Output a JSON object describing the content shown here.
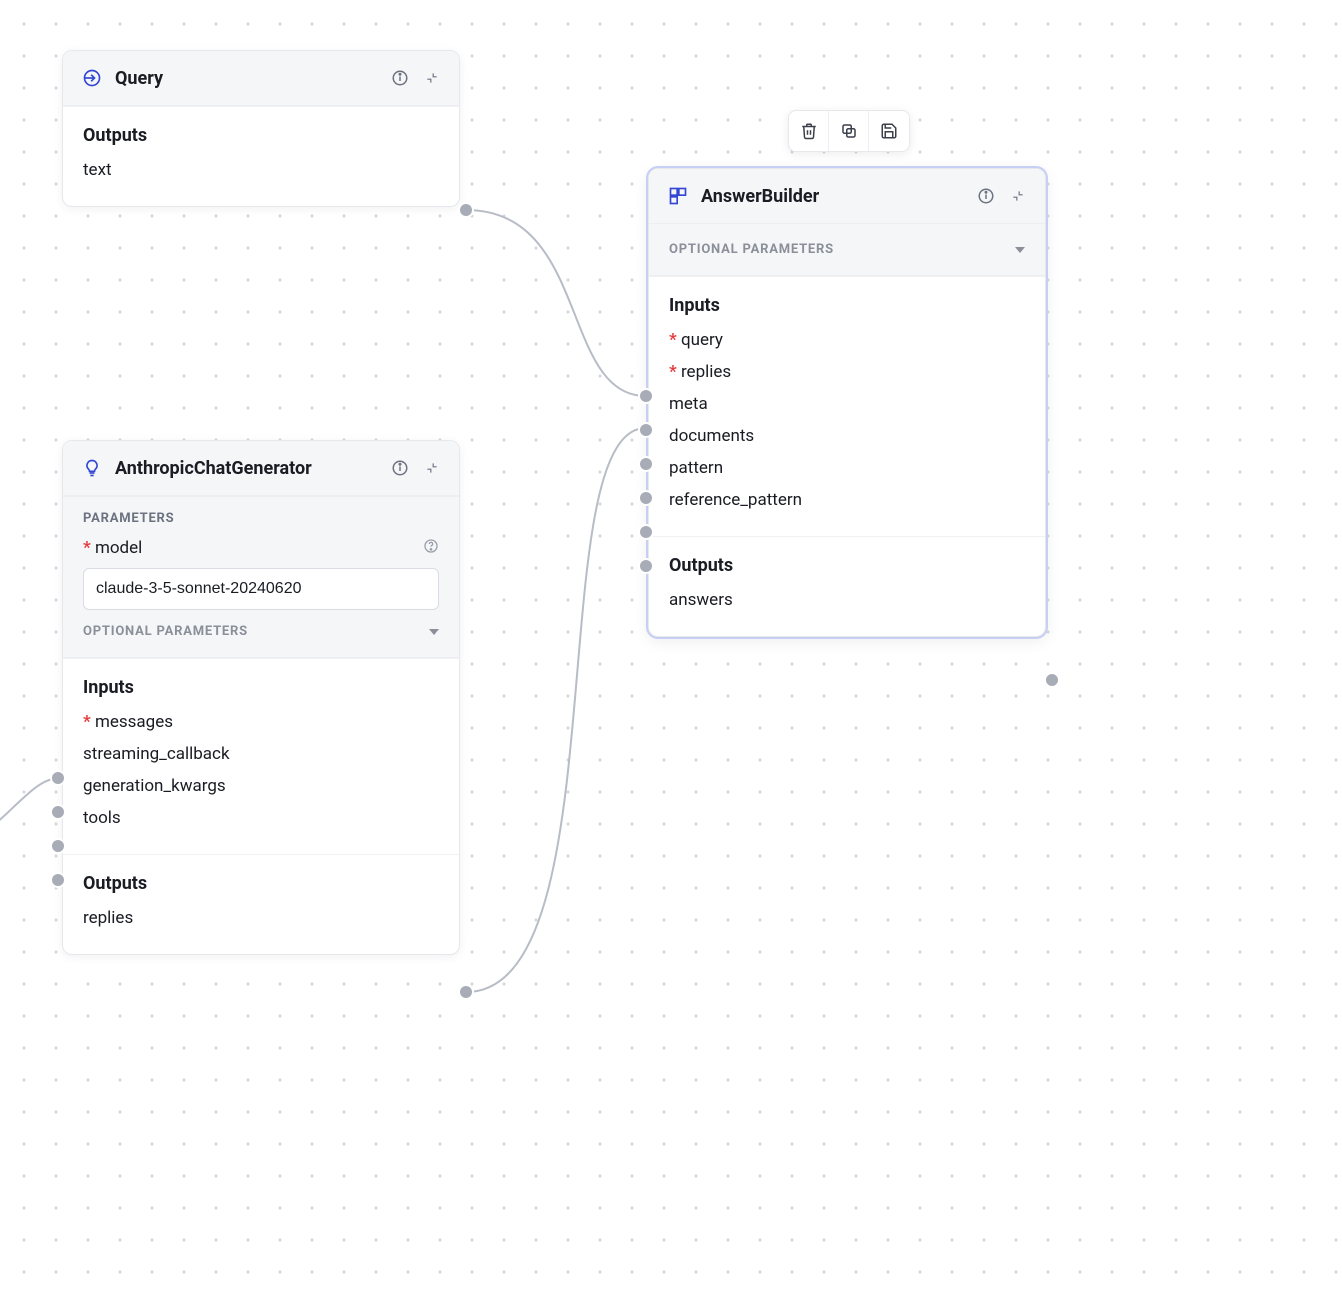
{
  "toolbar": {
    "buttons": [
      "delete",
      "duplicate",
      "save"
    ]
  },
  "common": {
    "parameters_label": "PARAMETERS",
    "optional_parameters_label": "OPTIONAL PARAMETERS",
    "inputs_label": "Inputs",
    "outputs_label": "Outputs"
  },
  "nodes": {
    "query": {
      "title": "Query",
      "icon": "input-arrow",
      "outputs": [
        "text"
      ]
    },
    "anthropic": {
      "title": "AnthropicChatGenerator",
      "icon": "lightbulb",
      "parameters": {
        "model": {
          "label": "model",
          "required": true,
          "value": "claude-3-5-sonnet-20240620"
        }
      },
      "inputs": [
        {
          "name": "messages",
          "required": true
        },
        {
          "name": "streaming_callback",
          "required": false
        },
        {
          "name": "generation_kwargs",
          "required": false
        },
        {
          "name": "tools",
          "required": false
        }
      ],
      "outputs": [
        "replies"
      ]
    },
    "answer_builder": {
      "title": "AnswerBuilder",
      "icon": "blocks",
      "selected": true,
      "inputs": [
        {
          "name": "query",
          "required": true
        },
        {
          "name": "replies",
          "required": true
        },
        {
          "name": "meta",
          "required": false
        },
        {
          "name": "documents",
          "required": false
        },
        {
          "name": "pattern",
          "required": false
        },
        {
          "name": "reference_pattern",
          "required": false
        }
      ],
      "outputs": [
        "answers"
      ]
    }
  }
}
